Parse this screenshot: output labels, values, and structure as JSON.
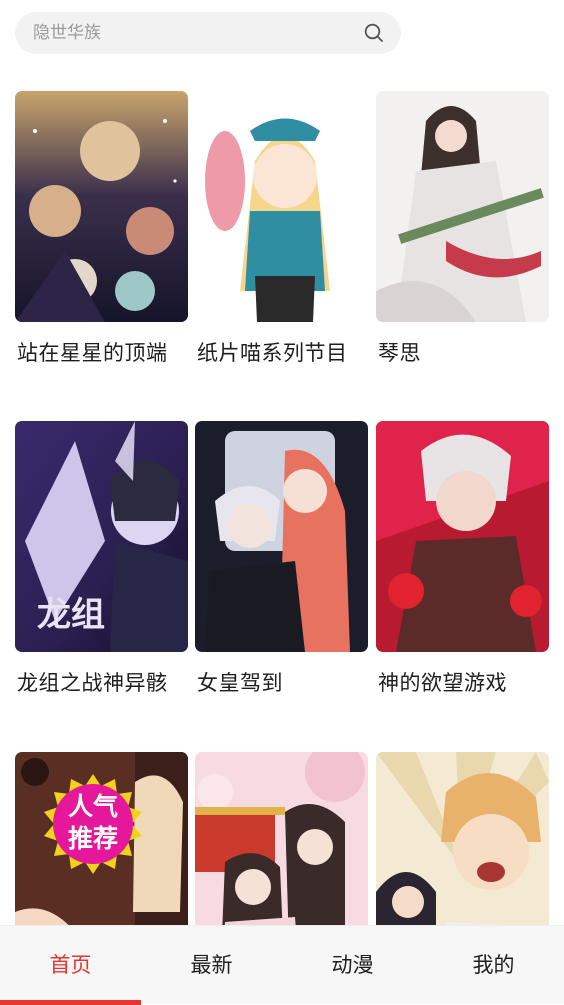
{
  "search": {
    "placeholder": "隐世华族",
    "icon": "search-icon"
  },
  "comics": [
    {
      "title": "站在星星的顶端",
      "palette": [
        "#1b1a2e",
        "#6a4f7c",
        "#d9a974"
      ]
    },
    {
      "title": "纸片喵系列节目",
      "palette": [
        "#ffffff",
        "#f6d58c",
        "#2f8ea1"
      ]
    },
    {
      "title": "琴思",
      "palette": [
        "#f3f1f0",
        "#3c2f2c",
        "#c63b4c"
      ]
    },
    {
      "title": "龙组之战神异骸",
      "palette": [
        "#20183d",
        "#6c55b8",
        "#d7c8f0"
      ]
    },
    {
      "title": "女皇驾到",
      "palette": [
        "#1c1d2a",
        "#e7e6ef",
        "#e7725f"
      ]
    },
    {
      "title": "神的欲望游戏",
      "palette": [
        "#d61d3a",
        "#e8e4e6",
        "#5a2b28"
      ]
    },
    {
      "title": "",
      "palette": [
        "#5a2f23",
        "#f5d7c2",
        "#e6b38a"
      ]
    },
    {
      "title": "",
      "palette": [
        "#f3c9d0",
        "#c93a2d",
        "#3b2a2a"
      ]
    },
    {
      "title": "",
      "palette": [
        "#f4e9d2",
        "#caa14a",
        "#e8b26a"
      ]
    }
  ],
  "badge": {
    "line1": "人气",
    "line2": "推荐",
    "color": "#e5179b",
    "ring": "#f1d31a"
  },
  "tabs": [
    {
      "label": "首页",
      "active": true
    },
    {
      "label": "最新",
      "active": false
    },
    {
      "label": "动漫",
      "active": false
    },
    {
      "label": "我的",
      "active": false
    }
  ],
  "accent": "#e5352d"
}
